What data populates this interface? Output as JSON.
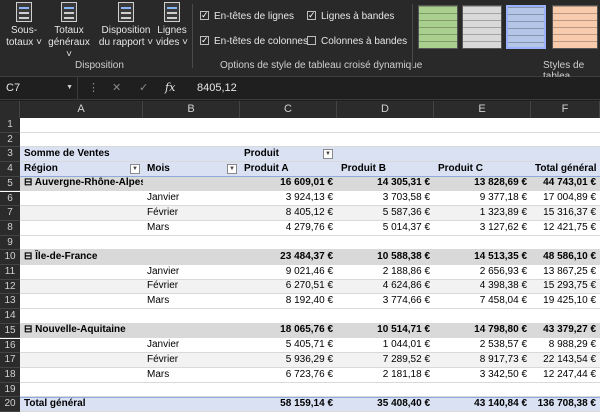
{
  "ribbon": {
    "buttons": [
      {
        "label": "Sous-totaux ˅",
        "line1": "Sous-",
        "line2": "totaux ˅"
      },
      {
        "label": "Totaux généraux ˅",
        "line1": "Totaux",
        "line2": "généraux ˅"
      },
      {
        "label": "Disposition du rapport ˅",
        "line1": "Disposition",
        "line2": "du rapport ˅"
      },
      {
        "label": "Lignes vides ˅",
        "line1": "Lignes",
        "line2": "vides ˅"
      }
    ],
    "group_disposition": "Disposition",
    "options": {
      "entetes_lignes": "En-têtes de lignes",
      "entetes_colonnes": "En-têtes de colonnes",
      "lignes_bandes": "Lignes à bandes",
      "colonnes_bandes": "Colonnes à bandes",
      "checked": {
        "entetes_lignes": true,
        "entetes_colonnes": true,
        "lignes_bandes": true,
        "colonnes_bandes": false
      }
    },
    "group_options": "Options de style de tableau croisé dynamique",
    "group_styles": "Styles de tablea",
    "style_colors": [
      "#70ad47",
      "#a5a5a5",
      "#4472c4",
      "#ed7d31"
    ]
  },
  "formula_bar": {
    "cell_ref": "C7",
    "cancel_icon": "close-icon",
    "enter_icon": "check-icon",
    "fx": "fx",
    "value": "8405,12"
  },
  "columns": [
    "A",
    "B",
    "C",
    "D",
    "E",
    "F"
  ],
  "rows": [
    {
      "n": "1",
      "a": "",
      "b": "",
      "c": "",
      "d": "",
      "e": "",
      "f": ""
    },
    {
      "n": "2",
      "a": "",
      "b": "",
      "c": "",
      "d": "",
      "e": "",
      "f": ""
    },
    {
      "n": "3",
      "a": "Somme de Ventes",
      "b": "",
      "c": "Produit",
      "d": "",
      "e": "",
      "f": ""
    },
    {
      "n": "4",
      "a": "Région",
      "b": "Mois",
      "c": "Produit A",
      "d": "Produit B",
      "e": "Produit C",
      "f": "Total général"
    },
    {
      "n": "5",
      "a": "⊟ Auvergne-Rhône-Alpes",
      "b": "",
      "c": "16 609,01 €",
      "d": "14 305,31 €",
      "e": "13 828,69 €",
      "f": "44 743,01 €"
    },
    {
      "n": "6",
      "a": "",
      "b": "Janvier",
      "c": "3 924,13 €",
      "d": "3 703,58 €",
      "e": "9 377,18 €",
      "f": "17 004,89 €"
    },
    {
      "n": "7",
      "a": "",
      "b": "Février",
      "c": "8 405,12 €",
      "d": "5 587,36 €",
      "e": "1 323,89 €",
      "f": "15 316,37 €"
    },
    {
      "n": "8",
      "a": "",
      "b": "Mars",
      "c": "4 279,76 €",
      "d": "5 014,37 €",
      "e": "3 127,62 €",
      "f": "12 421,75 €"
    },
    {
      "n": "9",
      "a": "",
      "b": "",
      "c": "",
      "d": "",
      "e": "",
      "f": ""
    },
    {
      "n": "10",
      "a": "⊟ Île-de-France",
      "b": "",
      "c": "23 484,37 €",
      "d": "10 588,38 €",
      "e": "14 513,35 €",
      "f": "48 586,10 €"
    },
    {
      "n": "11",
      "a": "",
      "b": "Janvier",
      "c": "9 021,46 €",
      "d": "2 188,86 €",
      "e": "2 656,93 €",
      "f": "13 867,25 €"
    },
    {
      "n": "12",
      "a": "",
      "b": "Février",
      "c": "6 270,51 €",
      "d": "4 624,86 €",
      "e": "4 398,38 €",
      "f": "15 293,75 €"
    },
    {
      "n": "13",
      "a": "",
      "b": "Mars",
      "c": "8 192,40 €",
      "d": "3 774,66 €",
      "e": "7 458,04 €",
      "f": "19 425,10 €"
    },
    {
      "n": "14",
      "a": "",
      "b": "",
      "c": "",
      "d": "",
      "e": "",
      "f": ""
    },
    {
      "n": "15",
      "a": "⊟ Nouvelle-Aquitaine",
      "b": "",
      "c": "18 065,76 €",
      "d": "10 514,71 €",
      "e": "14 798,80 €",
      "f": "43 379,27 €"
    },
    {
      "n": "16",
      "a": "",
      "b": "Janvier",
      "c": "5 405,71 €",
      "d": "1 044,01 €",
      "e": "2 538,57 €",
      "f": "8 988,29 €"
    },
    {
      "n": "17",
      "a": "",
      "b": "Février",
      "c": "5 936,29 €",
      "d": "7 289,52 €",
      "e": "8 917,73 €",
      "f": "22 143,54 €"
    },
    {
      "n": "18",
      "a": "",
      "b": "Mars",
      "c": "6 723,76 €",
      "d": "2 181,18 €",
      "e": "3 342,50 €",
      "f": "12 247,44 €"
    },
    {
      "n": "19",
      "a": "",
      "b": "",
      "c": "",
      "d": "",
      "e": "",
      "f": ""
    },
    {
      "n": "20",
      "a": "Total général",
      "b": "",
      "c": "58 159,14 €",
      "d": "35 408,40 €",
      "e": "43 140,84 €",
      "f": "136 708,38 €"
    }
  ]
}
